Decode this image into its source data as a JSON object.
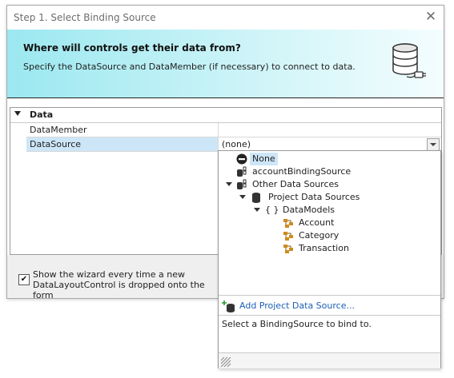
{
  "dialog": {
    "title": "Step 1. Select Binding Source",
    "close_glyph": "✕"
  },
  "banner": {
    "question": "Where will controls get their data from?",
    "subtitle": "Specify the DataSource and DataMember (if necessary) to connect to data.",
    "icon": "database-plug-icon"
  },
  "grid": {
    "category": "Data",
    "rows": [
      {
        "name": "DataMember",
        "value": ""
      },
      {
        "name": "DataSource",
        "value": "(none)"
      }
    ]
  },
  "footer": {
    "checkbox_checked": true,
    "checkbox_label": "Show the wizard every time a new DataLayoutControl is dropped onto the form"
  },
  "popup": {
    "tree": [
      {
        "label": "None",
        "icon": "none-icon"
      },
      {
        "label": "accountBindingSource",
        "icon": "binding-source-icon"
      },
      {
        "label": "Other Data Sources",
        "icon": "data-sources-icon"
      },
      {
        "label": "Project Data Sources",
        "icon": "database-icon"
      },
      {
        "label": "DataModels",
        "icon": "namespace-icon"
      },
      {
        "label": "Account",
        "icon": "class-icon"
      },
      {
        "label": "Category",
        "icon": "class-icon"
      },
      {
        "label": "Transaction",
        "icon": "class-icon"
      }
    ],
    "add_label": "Add Project Data Source...",
    "description": "Select a BindingSource to bind to."
  }
}
